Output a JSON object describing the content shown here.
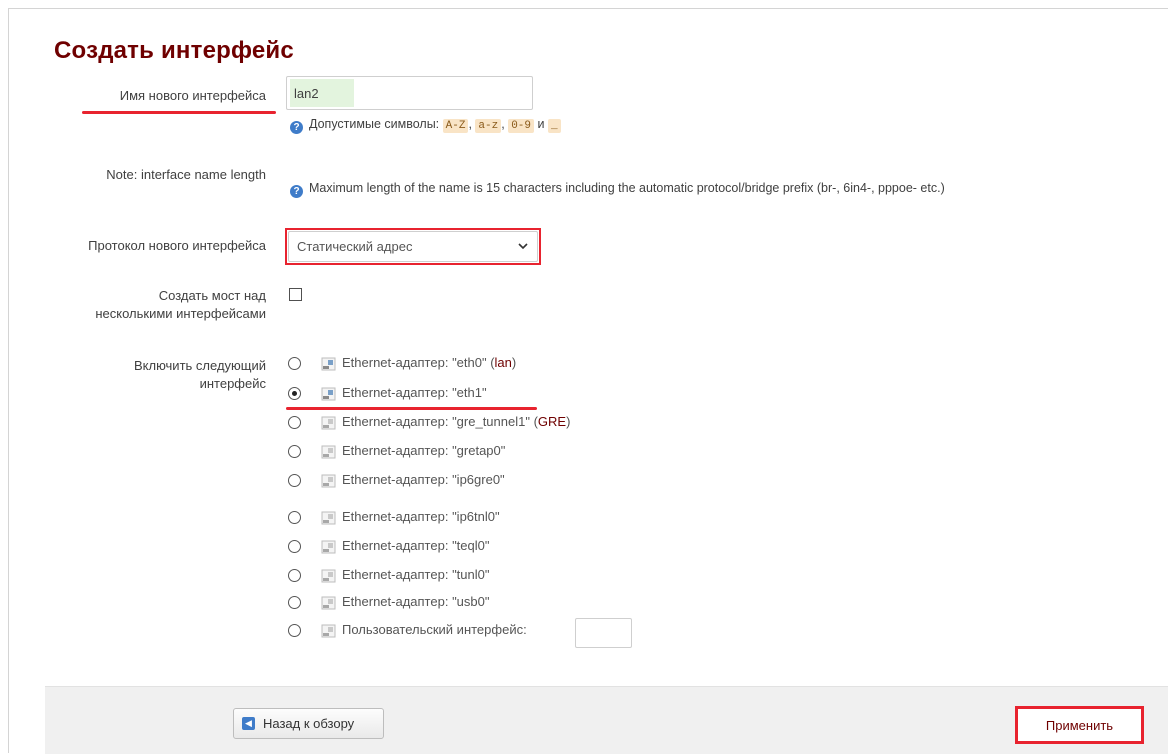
{
  "page": {
    "title": "Создать интерфейс"
  },
  "form": {
    "name_label": "Имя нового интерфейса",
    "name_value": "lan2",
    "name_hint_prefix": "Допустимые символы:",
    "name_hint_chars": [
      "A-Z",
      "a-z",
      "0-9",
      "_"
    ],
    "name_hint_sep1": ",",
    "name_hint_and": "и",
    "note_label": "Note: interface name length",
    "note_text": "Maximum length of the name is 15 characters including the automatic protocol/bridge prefix (br-, 6in4-, pppoe- etc.)",
    "protocol_label": "Протокол нового интерфейса",
    "protocol_value": "Статический адрес",
    "bridge_label_line1": "Создать мост над",
    "bridge_label_line2": "несколькими интерфейсами",
    "bridge_checked": false,
    "include_label_line1": "Включить следующий",
    "include_label_line2": "интерфейс",
    "interfaces": [
      {
        "prefix": "Ethernet-адаптер:",
        "name": "\"eth0\"",
        "network": "lan",
        "checked": false
      },
      {
        "prefix": "Ethernet-адаптер:",
        "name": "\"eth1\"",
        "network": "",
        "checked": true
      },
      {
        "prefix": "Ethernet-адаптер:",
        "name": "\"gre_tunnel1\"",
        "network": "GRE",
        "checked": false
      },
      {
        "prefix": "Ethernet-адаптер:",
        "name": "\"gretap0\"",
        "network": "",
        "checked": false
      },
      {
        "prefix": "Ethernet-адаптер:",
        "name": "\"ip6gre0\"",
        "network": "",
        "checked": false
      },
      {
        "prefix": "Ethernet-адаптер:",
        "name": "\"ip6tnl0\"",
        "network": "",
        "checked": false
      },
      {
        "prefix": "Ethernet-адаптер:",
        "name": "\"teql0\"",
        "network": "",
        "checked": false
      },
      {
        "prefix": "Ethernet-адаптер:",
        "name": "\"tunl0\"",
        "network": "",
        "checked": false
      },
      {
        "prefix": "Ethernet-адаптер:",
        "name": "\"usb0\"",
        "network": "",
        "checked": false
      }
    ],
    "custom_interface_label": "Пользовательский интерфейс:",
    "custom_interface_value": ""
  },
  "footer": {
    "back_label": "Назад к обзору",
    "apply_label": "Применить"
  },
  "colors": {
    "title": "#6f0000",
    "annotation_red": "#e8232f",
    "help_icon": "#3f7cc9",
    "highlight_green": "#e3f4de",
    "code_bg": "#f9e4c6"
  }
}
